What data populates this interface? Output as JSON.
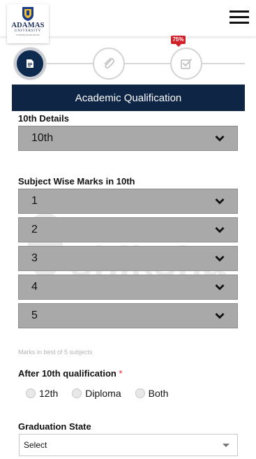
{
  "header": {
    "logo_brand": "ADAMAS",
    "logo_sub": "UNIVERSITY",
    "logo_tiny": "PURSUE EXCELLENCE"
  },
  "stepper": {
    "progress_badge": "75%",
    "active_step": 1,
    "steps": [
      "document",
      "attachment",
      "review"
    ]
  },
  "section_title": "Academic Qualification",
  "tenth_details": {
    "label": "10th Details",
    "selected": "10th"
  },
  "subject_marks": {
    "label": "Subject Wise Marks in 10th",
    "subjects": [
      "1",
      "2",
      "3",
      "4",
      "5"
    ],
    "hint": "Marks in best of 5 subjects"
  },
  "after_tenth": {
    "label": "After 10th qualification",
    "required_mark": "*",
    "options": [
      "12th",
      "Diploma",
      "Both"
    ]
  },
  "graduation_state": {
    "label": "Graduation State",
    "selected": "Select"
  },
  "watermark": "shiksha",
  "colors": {
    "navy": "#0e2546",
    "badge_red": "#d11f2a",
    "dropdown_gray": "#a9a9a9"
  }
}
